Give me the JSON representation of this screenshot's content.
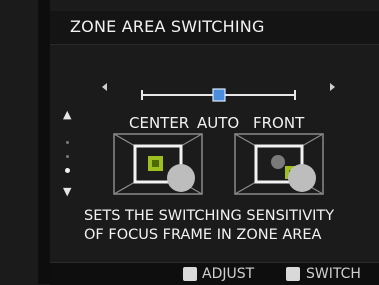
{
  "menu": {
    "title": "ZONE AREA SWITCHING",
    "options": [
      "CENTER",
      "AUTO",
      "FRONT"
    ],
    "selected": "AUTO",
    "description_line1": "SETS THE SWITCHING SENSITIVITY",
    "description_line2": "OF FOCUS FRAME IN ZONE AREA"
  },
  "footer": {
    "adjust_label": "ADJUST",
    "switch_label": "SWITCH"
  },
  "colors": {
    "accent": "#4a8ddc",
    "focus_green": "#9ec01e"
  }
}
